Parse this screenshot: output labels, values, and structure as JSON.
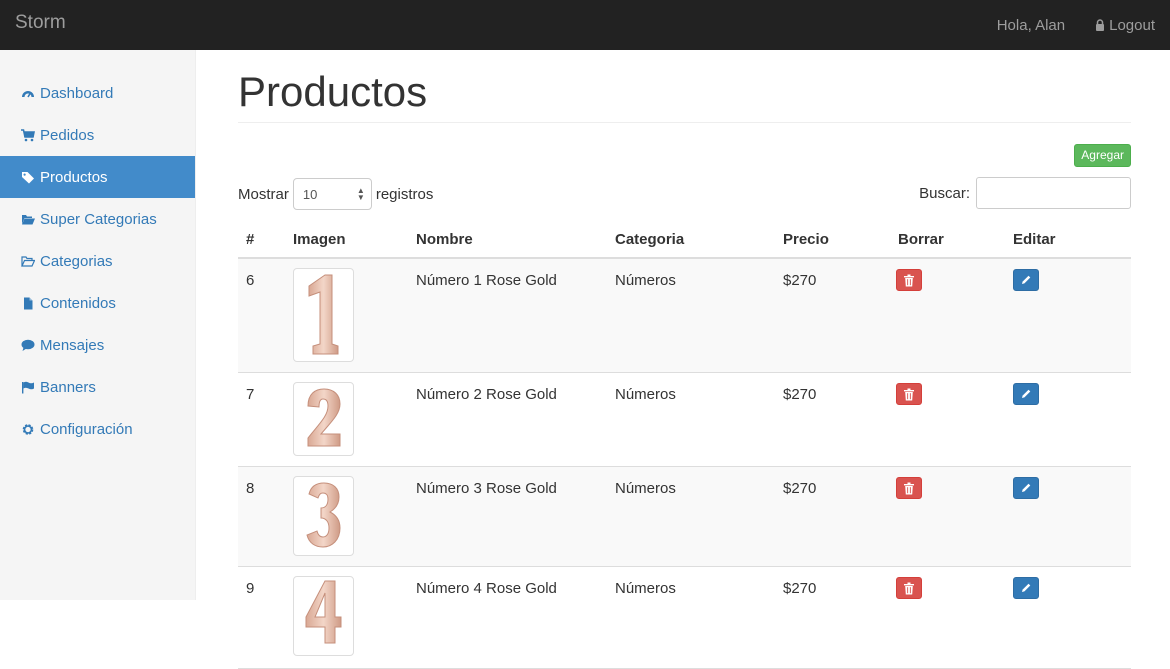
{
  "navbar": {
    "brand": "Storm",
    "greeting": "Hola, Alan",
    "logout_label": "Logout"
  },
  "sidebar": {
    "items": [
      {
        "label": "Dashboard",
        "icon": "dashboard-icon"
      },
      {
        "label": "Pedidos",
        "icon": "cart-icon"
      },
      {
        "label": "Productos",
        "icon": "tag-icon",
        "active": true
      },
      {
        "label": "Super Categorias",
        "icon": "folder-open-icon"
      },
      {
        "label": "Categorias",
        "icon": "folder-open-outline-icon"
      },
      {
        "label": "Contenidos",
        "icon": "file-icon"
      },
      {
        "label": "Mensajes",
        "icon": "comment-icon"
      },
      {
        "label": "Banners",
        "icon": "flag-icon"
      },
      {
        "label": "Configuración",
        "icon": "cog-icon"
      }
    ]
  },
  "main": {
    "title": "Productos",
    "add_button": "Agregar",
    "length": {
      "before": "Mostrar",
      "value": "10",
      "after": "registros"
    },
    "search_label": "Buscar:",
    "search_value": "",
    "columns": [
      "#",
      "Imagen",
      "Nombre",
      "Categoria",
      "Precio",
      "Borrar",
      "Editar"
    ],
    "rows": [
      {
        "id": "6",
        "digit": "1",
        "name": "Número 1 Rose Gold",
        "category": "Números",
        "price": "$270"
      },
      {
        "id": "7",
        "digit": "2",
        "name": "Número 2 Rose Gold",
        "category": "Números",
        "price": "$270"
      },
      {
        "id": "8",
        "digit": "3",
        "name": "Número 3 Rose Gold",
        "category": "Números",
        "price": "$270"
      },
      {
        "id": "9",
        "digit": "4",
        "name": "Número 4 Rose Gold",
        "category": "Números",
        "price": "$270"
      }
    ]
  },
  "colors": {
    "navbar_bg": "#222222",
    "link": "#337ab7",
    "active_bg": "#428bca",
    "success": "#5cb85c",
    "danger": "#d9534f",
    "balloon": "#e8c1b0"
  }
}
